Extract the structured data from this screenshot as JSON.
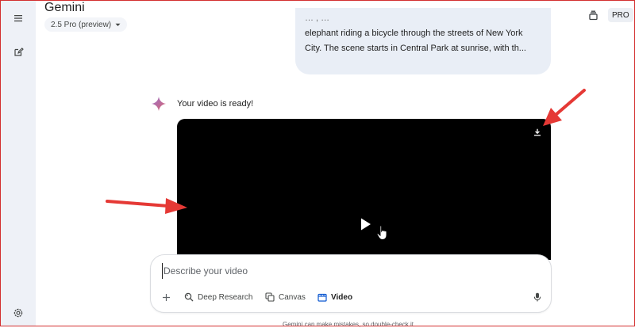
{
  "header": {
    "app_title": "Gemini",
    "model": "2.5 Pro (preview)",
    "pro_badge": "PRO"
  },
  "rail": {
    "icons": [
      "menu-icon",
      "new-chat-icon",
      "settings-icon"
    ]
  },
  "user_prompt": {
    "line_1": "… , …",
    "line_2": "elephant riding a bicycle through the streets of New York",
    "line_3": "City. The scene starts in Central Park at sunrise, with th..."
  },
  "response": {
    "text": "Your video is ready!",
    "video_icons": [
      "download-icon",
      "play-icon"
    ]
  },
  "composer": {
    "placeholder": "Describe your video",
    "tools": {
      "deep_research": "Deep Research",
      "canvas": "Canvas",
      "video": "Video"
    }
  },
  "footer": {
    "disclaimer": "Gemini can make mistakes, so double-check it"
  },
  "colors": {
    "rail_bg": "#eef1f7",
    "bubble_bg": "#e9eef6",
    "accent": "#0b57d0",
    "annotation_red": "#e53935",
    "spark": "#d96570"
  }
}
